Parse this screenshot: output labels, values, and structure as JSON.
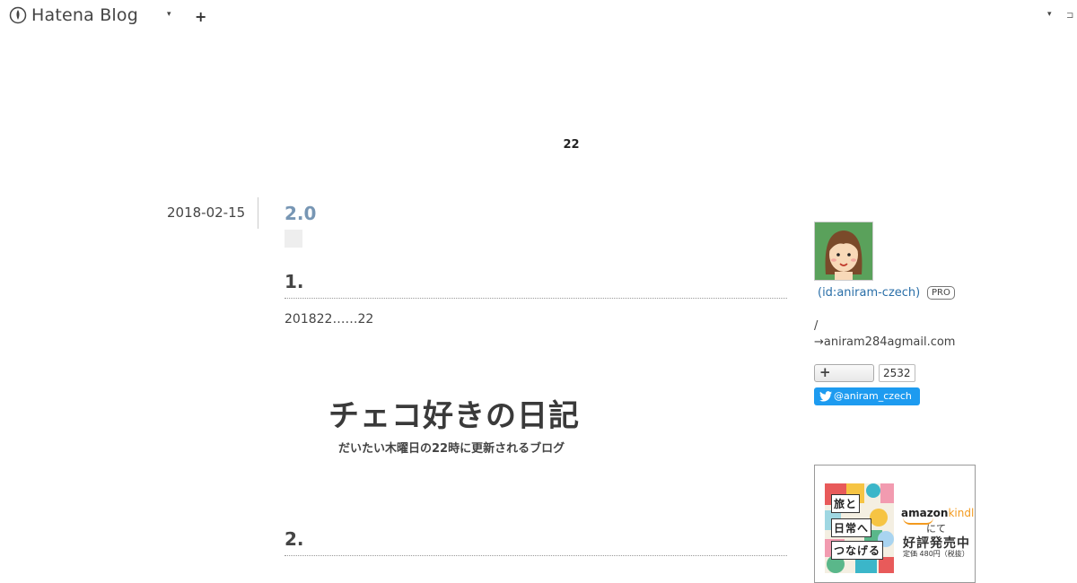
{
  "header": {
    "logo_text": "Hatena Blog",
    "plus_glyph": "+",
    "caret_glyph": "▾",
    "right_glyph": "⊐"
  },
  "blog": {
    "title": "22"
  },
  "entry": {
    "date": "2018-02-15",
    "title": "2.0",
    "section1_heading": "1.",
    "body_text": "201822……22",
    "embed_title": "チェコ好きの日記",
    "embed_subtitle": "だいたい木曜日の22時に更新されるブログ",
    "section2_heading": "2."
  },
  "sidebar": {
    "author_id": "(id:aniram-czech)",
    "pro_badge": "PRO",
    "slash": "/",
    "email": "→aniram284agmail.com",
    "follow_plus": "+",
    "follower_count": "2532",
    "twitter_label": "@aniram_czech",
    "ad": {
      "book_label_1": "旅と",
      "book_label_2": "日常へ",
      "book_label_3": "つなげる",
      "amazon": "amazon",
      "kindle": "kindle",
      "nite": "にて",
      "sale": "好評発売中",
      "price": "定価 480円（税抜）"
    }
  },
  "colors": {
    "entry_title": "#7796b4",
    "link": "#2a6fa8",
    "twitter": "#1d9bf0",
    "avatar_bg": "#5aa15b",
    "amazon_accent": "#f39a1e"
  }
}
